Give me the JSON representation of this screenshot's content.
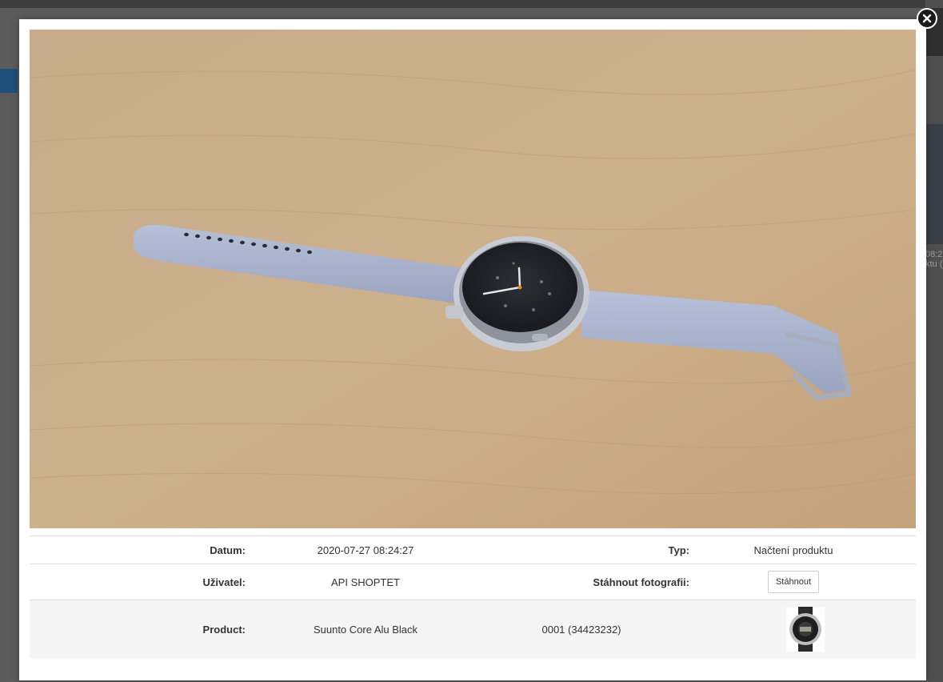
{
  "background_page": {
    "right_text_1": "08:2",
    "right_text_2": "ktu ("
  },
  "modal": {
    "photo_alt": "Product photo",
    "info": {
      "datum_label": "Datum:",
      "datum_value": "2020-07-27 08:24:27",
      "typ_label": "Typ:",
      "typ_value": "Načtení produktu",
      "uzivatel_label": "Uživatel:",
      "uzivatel_value": "API SHOPTET",
      "download_label": "Stáhnout fotografii:",
      "download_button": "Stáhnout",
      "product_label": "Product:",
      "product_name": "Suunto Core Alu Black",
      "product_code": "0001 (34423232)"
    }
  },
  "icons": {
    "close": "close-icon",
    "product_thumbnail": "watch-icon"
  },
  "colors": {
    "overlay": "#4a4a4a",
    "modal_bg": "#ffffff",
    "row_alt_bg": "#f5f5f5",
    "wood": "#c9ab86"
  }
}
